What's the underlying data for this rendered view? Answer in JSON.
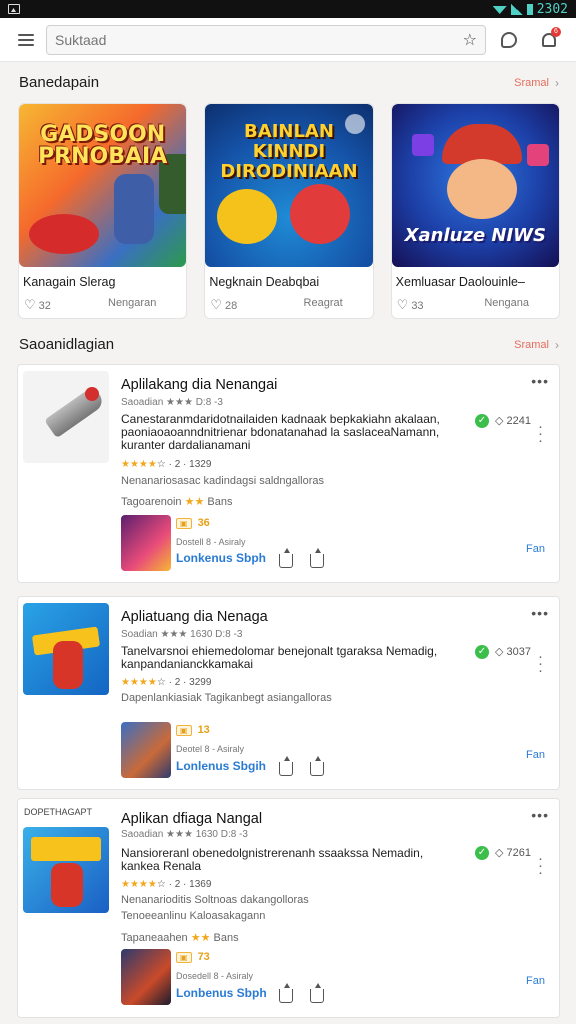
{
  "status_bar": {
    "time": "2302"
  },
  "search": {
    "placeholder": "Suktaad"
  },
  "notifications": {
    "badge_count": "6"
  },
  "featured": {
    "title": "Banedapain",
    "see_all": "Sramal",
    "items": [
      {
        "art_title": "GADSOON PRNOBAIA",
        "name": "Kanagain Slerag",
        "likes": "32",
        "category": "Nengaran"
      },
      {
        "art_title": "BAINLAN KINNDI DIRODINIAAN",
        "name": "Negknain Deabqbai",
        "likes": "28",
        "category": "Reagrat"
      },
      {
        "art_title": "Xanluze NIWS",
        "name": "Xemluasar Daolouinle–",
        "likes": "33",
        "category": "Nengana"
      }
    ]
  },
  "list_section": {
    "title": "Saoanidlagian",
    "see_all": "Sramal",
    "items": [
      {
        "title": "Aplilakang dia Nenangai",
        "rating_line": "Saoadian ★★★ D:8 -3",
        "description": "Canestaranmdaridotnailaiden kadnaak bepkakiahn akalaan, paoniaoaoanndnitrienar bdonatanahad la saslaceaNamann, kuranter dardalianamani",
        "rank": "2241",
        "stars_line": "1329",
        "desc2": "Nenanariosasac kadindagsi saldngalloras",
        "tagline": "Tagoarenoin",
        "tag_badge": "Bans",
        "sub_badge": "36",
        "sub_line": "Dostell 8 - Asiraly",
        "sub_link": "Lonkenus Sbph",
        "fan": "Fan"
      },
      {
        "title": "Apliatuang dia Nenaga",
        "rating_line": "Soadian ★★★ 1630 D:8 -3",
        "description": "Tanelvarsnoi ehiemedolomar benejonalt tgaraksa Nemadig, kanpandanianckkamakai",
        "rank": "3037",
        "stars_line": "3299",
        "desc2": "Dapenlankiasiak Tagikanbegt asiangalloras",
        "sub_badge": "13",
        "sub_line": "Deotel 8 - Asiraly",
        "sub_link": "Lonlenus Sbgih",
        "fan": "Fan"
      },
      {
        "title": "Aplikan dfiaga Nangal",
        "corner_label": "DOPETHAGAPT",
        "rating_line": "Saoadian ★★★ 1630 D:8 -3",
        "description": "Nansioreranl obenedolgnistrerenanh ssaakssa Nemadin, kankea Renala",
        "rank": "7261",
        "stars_line": "1369",
        "desc2": "Nenanarioditis Soltnoas dakangolloras",
        "tagline2": "Tenoeeanlinu Kaloasakagann",
        "tagline": "Tapaneaahen",
        "tag_badge": "Bans",
        "sub_badge": "73",
        "sub_line": "Dosedell 8 - Asiraly",
        "sub_link": "Lonbenus Sbph",
        "fan": "Fan"
      }
    ]
  }
}
